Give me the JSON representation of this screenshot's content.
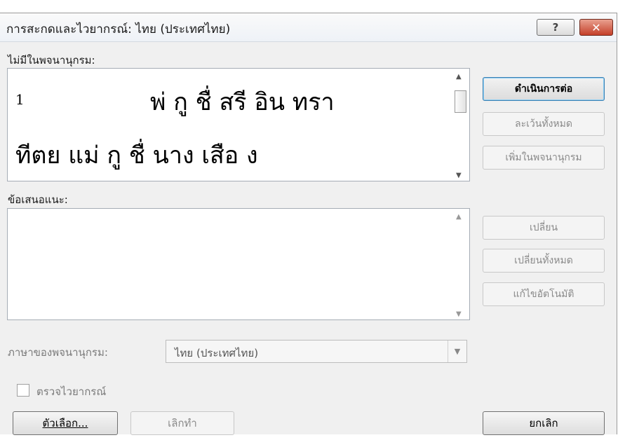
{
  "window": {
    "title": "การสะกดและไวยากรณ์: ไทย (ประเทศไทย)",
    "help_label": "?",
    "close_label": "✕"
  },
  "not_in_dictionary": {
    "label": "ไม่มีในพจนานุกรม:",
    "line1_number": "1",
    "line1_text": "พ่ กู ชื่ สรี อิน ทรา",
    "line2_text": "ทีตย แม่ กู ชื่ นาง เสือ ง"
  },
  "suggestions": {
    "label": "ข้อเสนอแนะ:"
  },
  "buttons": {
    "continue": "ดำเนินการต่อ",
    "ignore_all": "ละเว้นทั้งหมด",
    "add_to_dictionary": "เพิ่มในพจนานุกรม",
    "change": "เปลี่ยน",
    "change_all": "เปลี่ยนทั้งหมด",
    "autocorrect": "แก้ไขอัตโนมัติ",
    "options": "ตัวเลือก...",
    "undo": "เลิกทำ",
    "cancel": "ยกเลิก"
  },
  "dictionary_language": {
    "label": "ภาษาของพจนานุกรม:",
    "value": "ไทย (ประเทศไทย)"
  },
  "check_grammar": {
    "label": "ตรวจไวยากรณ์",
    "checked": false
  },
  "colors": {
    "close_button": "#c4402a",
    "default_button_border": "#3c7fb1"
  }
}
